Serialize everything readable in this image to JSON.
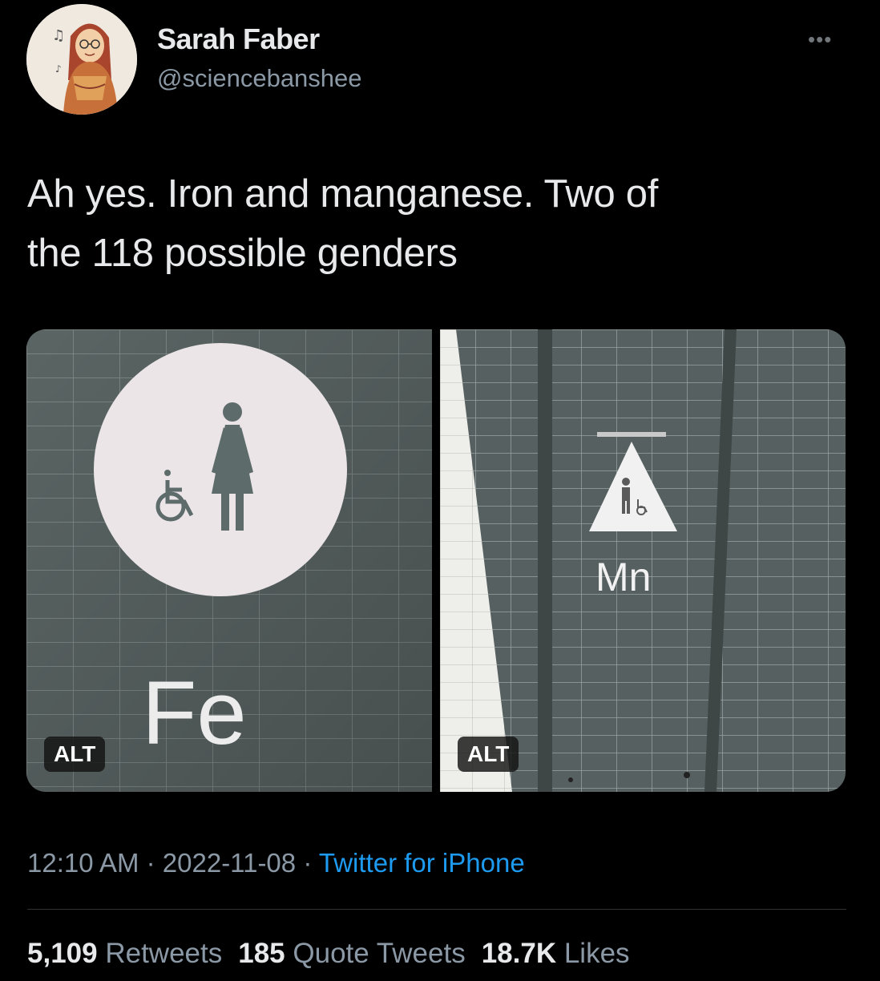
{
  "tweet": {
    "author_name": "Sarah Faber",
    "author_handle": "@sciencebanshee",
    "more_icon": "more-dots-icon",
    "text_line1": "Ah yes. Iron and manganese. Two of",
    "text_line2": "the 118 possible genders",
    "media": [
      {
        "sign_text": "Fe",
        "alt_label": "ALT"
      },
      {
        "sign_text": "Mn",
        "alt_label": "ALT"
      }
    ],
    "time": "12:10 AM",
    "sep": "·",
    "date": "2022-11-08",
    "source": "Twitter for iPhone",
    "stats": {
      "retweets_count": "5,109",
      "retweets_label": "Retweets",
      "quotes_count": "185",
      "quotes_label": "Quote Tweets",
      "likes_count": "18.7K",
      "likes_label": "Likes"
    }
  },
  "colors": {
    "background": "#000000",
    "text_primary": "#e7e9ea",
    "text_secondary": "#8b98a5",
    "link": "#1d9bf0"
  }
}
